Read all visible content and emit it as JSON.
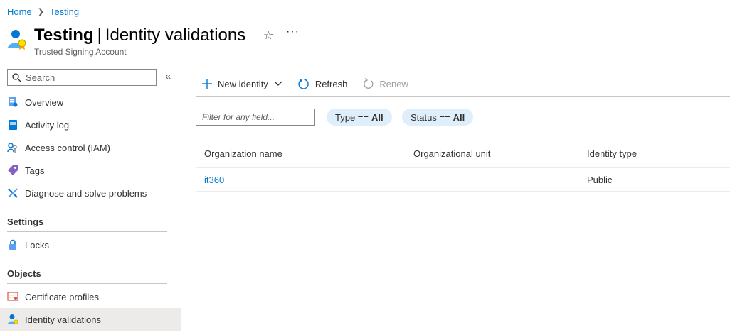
{
  "breadcrumb": {
    "home": "Home",
    "current": "Testing"
  },
  "header": {
    "resource_name": "Testing",
    "pipe": "|",
    "page_title": "Identity validations",
    "subtitle": "Trusted Signing Account",
    "favorite_icon": "star-icon",
    "more_icon": "ellipsis-icon"
  },
  "sidebar": {
    "search_placeholder": "Search",
    "collapse_glyph": "«",
    "items": [
      {
        "label": "Overview",
        "icon": "overview-icon"
      },
      {
        "label": "Activity log",
        "icon": "activity-log-icon"
      },
      {
        "label": "Access control (IAM)",
        "icon": "access-control-icon"
      },
      {
        "label": "Tags",
        "icon": "tag-icon"
      },
      {
        "label": "Diagnose and solve problems",
        "icon": "wrench-icon"
      }
    ],
    "sections": [
      {
        "title": "Settings",
        "items": [
          {
            "label": "Locks",
            "icon": "lock-icon"
          }
        ]
      },
      {
        "title": "Objects",
        "items": [
          {
            "label": "Certificate profiles",
            "icon": "certificate-icon"
          },
          {
            "label": "Identity validations",
            "icon": "identity-icon",
            "active": true
          }
        ]
      }
    ]
  },
  "toolbar": {
    "new_identity": "New identity",
    "refresh": "Refresh",
    "renew": "Renew"
  },
  "filters": {
    "placeholder": "Filter for any field...",
    "type_label": "Type ==",
    "type_value": "All",
    "status_label": "Status ==",
    "status_value": "All"
  },
  "table": {
    "columns": [
      "Organization name",
      "Organizational unit",
      "Identity type"
    ],
    "rows": [
      {
        "organization_name": "it360",
        "organizational_unit": "",
        "identity_type": "Public"
      }
    ]
  },
  "colors": {
    "accent": "#0078d4",
    "pill_bg": "#dfeefb",
    "active_nav_bg": "#edebe9"
  }
}
